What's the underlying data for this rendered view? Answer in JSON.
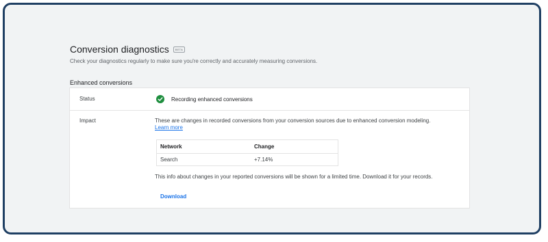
{
  "header": {
    "title": "Conversion diagnostics",
    "beta_badge": "BETA",
    "subtitle": "Check your diagnostics regularly to make sure you're correctly and accurately measuring conversions."
  },
  "section": {
    "title": "Enhanced conversions"
  },
  "status": {
    "label": "Status",
    "value": "Recording enhanced conversions",
    "icon": "check-circle-icon",
    "color": "#1e8e3e"
  },
  "impact": {
    "label": "Impact",
    "description": "These are changes in recorded conversions from your conversion sources due to enhanced conversion modeling.",
    "learn_more": "Learn more",
    "table": {
      "headers": [
        "Network",
        "Change"
      ],
      "rows": [
        [
          "Search",
          "+7.14%"
        ]
      ]
    },
    "info": "This info about changes in your reported conversions will be shown for a limited time. Download it for your records.",
    "download_label": "Download"
  }
}
